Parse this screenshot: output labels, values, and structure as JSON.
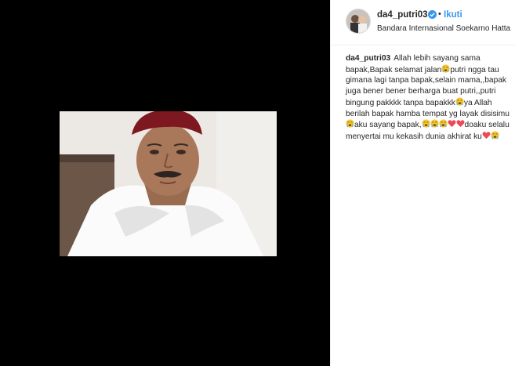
{
  "post": {
    "username": "da4_putri03",
    "follow_label": "Ikuti",
    "separator": "•",
    "location": "Bandara Internasional Soekarno Hatta",
    "caption_user": "da4_putri03",
    "caption_segments": [
      {
        "t": "text",
        "v": "Allah lebih sayang sama bapak,Bapak selamat jalan"
      },
      {
        "t": "emoji",
        "v": "crying-face"
      },
      {
        "t": "text",
        "v": "putri ngga tau gimana lagi tanpa bapak,selain mama,,bapak juga bener bener berharga buat putri,,putri bingung pakkkk tanpa bapakkk"
      },
      {
        "t": "emoji",
        "v": "crying-face"
      },
      {
        "t": "text",
        "v": "ya Allah berilah bapak hamba tempat yg layak disisimu"
      },
      {
        "t": "emoji",
        "v": "crying-face"
      },
      {
        "t": "text",
        "v": "aku sayang bapak,"
      },
      {
        "t": "emoji",
        "v": "crying-face"
      },
      {
        "t": "emoji",
        "v": "crying-face"
      },
      {
        "t": "emoji",
        "v": "crying-face"
      },
      {
        "t": "emoji",
        "v": "red-heart"
      },
      {
        "t": "emoji",
        "v": "red-heart"
      },
      {
        "t": "text",
        "v": "doaku selalu menyertai mu kekasih dunia akhirat ku"
      },
      {
        "t": "emoji",
        "v": "red-heart"
      },
      {
        "t": "emoji",
        "v": "crying-face"
      }
    ]
  },
  "colors": {
    "media_bg": "#000000",
    "follow": "#3897f0",
    "verified": "#3897f0",
    "text": "#262626",
    "heart": "#ed4956",
    "emoji_face": "#f7c631"
  },
  "icons": {
    "verified": "verified-badge-icon",
    "avatar": "profile-avatar"
  }
}
